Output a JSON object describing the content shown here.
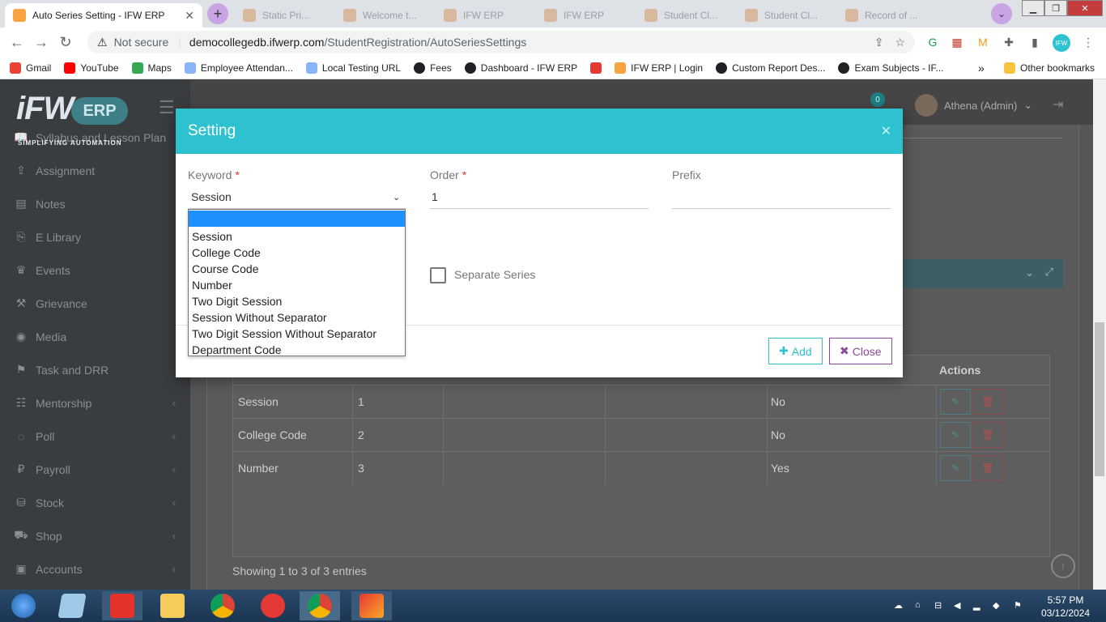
{
  "browser": {
    "active_tab_title": "Auto Series Setting - IFW ERP",
    "inactive_tabs": [
      "Static Pri...",
      "Welcome t...",
      "IFW ERP",
      "IFW ERP",
      "Student Cl...",
      "Student Cl...",
      "Record of ..."
    ],
    "url_security": "Not secure",
    "url_host": "democollegedb.ifwerp.com",
    "url_path": "/StudentRegistration/AutoSeriesSettings",
    "bookmarks": [
      "Gmail",
      "YouTube",
      "Maps",
      "Employee Attendan...",
      "Local Testing URL",
      "Fees",
      "Dashboard - IFW ERP",
      "",
      "IFW ERP | Login",
      "Custom Report Des...",
      "Exam Subjects - IF..."
    ],
    "bookmarks_overflow": "»",
    "other_bookmarks": "Other bookmarks"
  },
  "app": {
    "logo_text": "iFW",
    "logo_badge": "ERP",
    "logo_tagline": "SIMPLIFYING AUTOMATION",
    "notification_count": "0",
    "user_name": "Athena (Admin)",
    "sidebar": [
      {
        "label": "Syllabus and Lesson Plan",
        "icon": "book-icon",
        "has_children": false
      },
      {
        "label": "Assignment",
        "icon": "upload-icon",
        "has_children": false
      },
      {
        "label": "Notes",
        "icon": "notes-icon",
        "has_children": false
      },
      {
        "label": "E Library",
        "icon": "library-icon",
        "has_children": false
      },
      {
        "label": "Events",
        "icon": "trophy-icon",
        "has_children": false
      },
      {
        "label": "Grievance",
        "icon": "gavel-icon",
        "has_children": false
      },
      {
        "label": "Media",
        "icon": "eye-icon",
        "has_children": false
      },
      {
        "label": "Task and DRR",
        "icon": "task-icon",
        "has_children": false
      },
      {
        "label": "Mentorship",
        "icon": "users-icon",
        "has_children": true
      },
      {
        "label": "Poll",
        "icon": "poll-icon",
        "has_children": true
      },
      {
        "label": "Payroll",
        "icon": "payroll-icon",
        "has_children": true
      },
      {
        "label": "Stock",
        "icon": "stock-icon",
        "has_children": true
      },
      {
        "label": "Shop",
        "icon": "cart-icon",
        "has_children": true
      },
      {
        "label": "Accounts",
        "icon": "accounts-icon",
        "has_children": true
      }
    ]
  },
  "table": {
    "actions_header": "Actions",
    "rows": [
      {
        "keyword": "Session",
        "order": "1",
        "separate": "No"
      },
      {
        "keyword": "College Code",
        "order": "2",
        "separate": "No"
      },
      {
        "keyword": "Number",
        "order": "3",
        "separate": "Yes"
      }
    ],
    "footer": "Showing 1 to 3 of 3 entries"
  },
  "modal": {
    "title": "Setting",
    "keyword_label": "Keyword",
    "keyword_value": "Session",
    "order_label": "Order",
    "order_value": "1",
    "prefix_label": "Prefix",
    "prefix_value": "",
    "required_mark": "*",
    "separate_series_label": "Separate Series",
    "separate_series_checked": false,
    "keyword_options": [
      "",
      "Session",
      "College Code",
      "Course Code",
      "Number",
      "Two Digit Session",
      "Session Without Separator",
      "Two Digit Session Without Separator",
      "Department Code"
    ],
    "add_button": "Add",
    "close_button": "Close"
  },
  "taskbar": {
    "time": "5:57 PM",
    "date": "03/12/2024"
  },
  "colors": {
    "accent": "#2ec2d0",
    "close_btn": "#8b4a9b",
    "sidebar_bg": "#3a3d40",
    "highlight": "#1e90ff"
  }
}
